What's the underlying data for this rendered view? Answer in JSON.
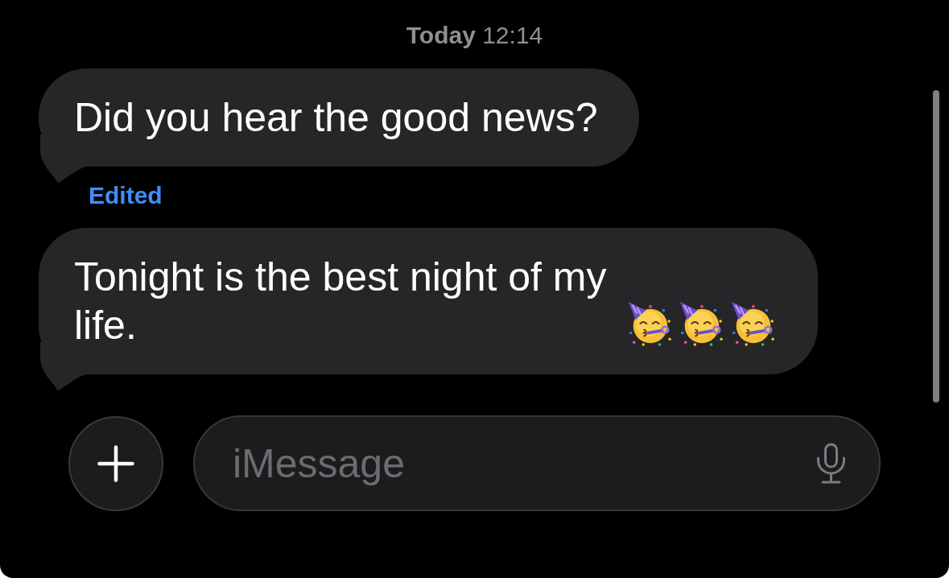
{
  "timestamp": "**Today** 12:14",
  "messages": [
    {
      "parts": [
        {
          "kind": "text",
          "text": "Did you hear the good news?"
        }
      ],
      "edited_label": "Edited"
    },
    {
      "parts": [
        {
          "kind": "text",
          "text": "Tonight is the best night of my life."
        },
        {
          "kind": "emoji"
        },
        {
          "kind": "emoji"
        },
        {
          "kind": "emoji"
        }
      ]
    }
  ],
  "composer": {
    "placeholder": "iMessage"
  }
}
